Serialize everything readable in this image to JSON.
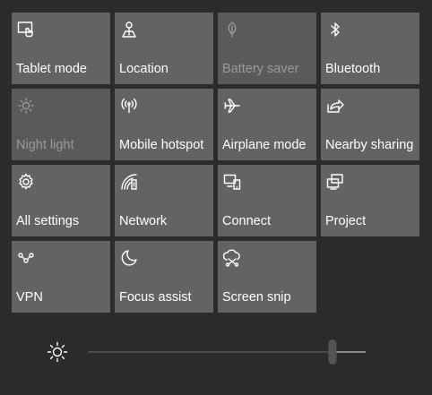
{
  "quick_actions": [
    {
      "id": "tablet-mode",
      "label": "Tablet mode",
      "icon": "tablet-mode-icon",
      "enabled": true
    },
    {
      "id": "location",
      "label": "Location",
      "icon": "location-icon",
      "enabled": true
    },
    {
      "id": "battery-saver",
      "label": "Battery saver",
      "icon": "battery-saver-icon",
      "enabled": false
    },
    {
      "id": "bluetooth",
      "label": "Bluetooth",
      "icon": "bluetooth-icon",
      "enabled": true
    },
    {
      "id": "night-light",
      "label": "Night light",
      "icon": "night-light-icon",
      "enabled": false
    },
    {
      "id": "mobile-hotspot",
      "label": "Mobile hotspot",
      "icon": "mobile-hotspot-icon",
      "enabled": true
    },
    {
      "id": "airplane-mode",
      "label": "Airplane mode",
      "icon": "airplane-icon",
      "enabled": true
    },
    {
      "id": "nearby-sharing",
      "label": "Nearby sharing",
      "icon": "nearby-sharing-icon",
      "enabled": true
    },
    {
      "id": "all-settings",
      "label": "All settings",
      "icon": "gear-icon",
      "enabled": true
    },
    {
      "id": "network",
      "label": "Network",
      "icon": "network-icon",
      "enabled": true
    },
    {
      "id": "connect",
      "label": "Connect",
      "icon": "connect-icon",
      "enabled": true
    },
    {
      "id": "project",
      "label": "Project",
      "icon": "project-icon",
      "enabled": true
    },
    {
      "id": "vpn",
      "label": "VPN",
      "icon": "vpn-icon",
      "enabled": true
    },
    {
      "id": "focus-assist",
      "label": "Focus assist",
      "icon": "moon-icon",
      "enabled": true
    },
    {
      "id": "screen-snip",
      "label": "Screen snip",
      "icon": "screen-snip-icon",
      "enabled": true
    }
  ],
  "brightness": {
    "icon": "brightness-sun-icon",
    "level": 0.88
  },
  "colors": {
    "background": "#2b2b2b",
    "tile": "#636363",
    "tile_disabled": "#5a5a5a",
    "text": "#ffffff",
    "text_disabled": "#9a9a9a"
  }
}
